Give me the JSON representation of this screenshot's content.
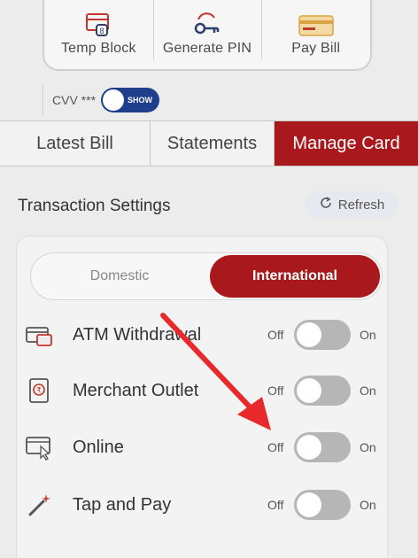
{
  "quick_actions": [
    {
      "label": "Temp Block",
      "icon": "card-lock-icon"
    },
    {
      "label": "Generate PIN",
      "icon": "key-icon"
    },
    {
      "label": "Pay Bill",
      "icon": "bill-card-icon"
    }
  ],
  "cvv": {
    "label": "CVV ***",
    "toggle_text": "SHOW"
  },
  "tabs": [
    {
      "label": "Latest Bill",
      "active": false
    },
    {
      "label": "Statements",
      "active": false
    },
    {
      "label": "Manage Card",
      "active": true
    }
  ],
  "transaction_settings": {
    "title": "Transaction Settings",
    "refresh_label": "Refresh",
    "segments": {
      "domestic": "Domestic",
      "international": "International",
      "selected": "International"
    },
    "rows": [
      {
        "label": "ATM Withdrawal",
        "icon": "atm-card-icon",
        "off": "Off",
        "on": "On",
        "state": "off"
      },
      {
        "label": "Merchant Outlet",
        "icon": "receipt-icon",
        "off": "Off",
        "on": "On",
        "state": "off"
      },
      {
        "label": "Online",
        "icon": "laptop-click-icon",
        "off": "Off",
        "on": "On",
        "state": "off"
      },
      {
        "label": "Tap and Pay",
        "icon": "magic-wand-icon",
        "off": "Off",
        "on": "On",
        "state": "off"
      }
    ]
  },
  "colors": {
    "accent": "#a8181c",
    "toggle_blue": "#1f3e8c",
    "annotation_arrow": "#e8282b"
  }
}
